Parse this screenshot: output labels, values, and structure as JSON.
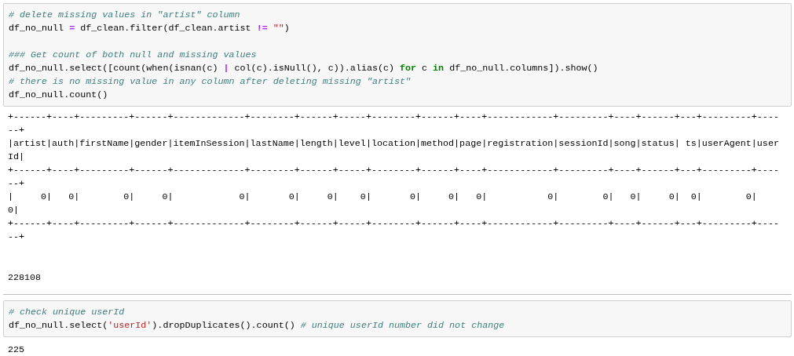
{
  "cells": [
    {
      "code": [
        {
          "tokens": [
            {
              "kind": "comment",
              "text": "# delete missing values in \"artist\" column"
            }
          ]
        },
        {
          "tokens": [
            {
              "kind": "plain",
              "text": "df_no_null "
            },
            {
              "kind": "operator",
              "text": "="
            },
            {
              "kind": "plain",
              "text": " df_clean.filter(df_clean.artist "
            },
            {
              "kind": "operator",
              "text": "!="
            },
            {
              "kind": "string",
              "text": " \"\""
            },
            {
              "kind": "plain",
              "text": ")"
            }
          ]
        },
        {
          "kind": "blank"
        },
        {
          "tokens": [
            {
              "kind": "comment",
              "text": "### Get count of both null and missing values"
            }
          ]
        },
        {
          "tokens": [
            {
              "kind": "plain",
              "text": "df_no_null.select([count(when(isnan(c) "
            },
            {
              "kind": "operator",
              "text": "|"
            },
            {
              "kind": "plain",
              "text": " col(c).isNull(), c)).alias(c) "
            },
            {
              "kind": "keyword",
              "text": "for"
            },
            {
              "kind": "plain",
              "text": " c "
            },
            {
              "kind": "keyword",
              "text": "in"
            },
            {
              "kind": "plain",
              "text": " df_no_null.columns]).show()"
            }
          ]
        },
        {
          "tokens": [
            {
              "kind": "comment",
              "text": "# there is no missing value in any column after deleting missing \"artist\""
            }
          ]
        },
        {
          "tokens": [
            {
              "kind": "plain",
              "text": "df_no_null.count()"
            }
          ]
        }
      ],
      "outputs": [
        {
          "kind": "stream",
          "lines": [
            "+------+----+---------+------+-------------+--------+------+-----+--------+------+----+------------+---------+----+------+---+---------+----",
            "--+",
            "|artist|auth|firstName|gender|itemInSession|lastName|length|level|location|method|page|registration|sessionId|song|status| ts|userAgent|user",
            "Id|",
            "+------+----+---------+------+-------------+--------+------+-----+--------+------+----+------------+---------+----+------+---+---------+----",
            "--+",
            "|     0|   0|        0|     0|            0|       0|     0|    0|       0|     0|   0|           0|        0|   0|     0|  0|        0|    ",
            "0|",
            "+------+----+---------+------+-------------+--------+------+-----+--------+------+----+------------+---------+----+------+---+---------+----",
            "--+"
          ]
        },
        {
          "kind": "result",
          "lines": [
            "228108"
          ]
        }
      ]
    },
    {
      "code": [
        {
          "tokens": [
            {
              "kind": "comment",
              "text": "# check unique userId"
            }
          ]
        },
        {
          "tokens": [
            {
              "kind": "plain",
              "text": "df_no_null.select("
            },
            {
              "kind": "string",
              "text": "'userId'"
            },
            {
              "kind": "plain",
              "text": ").dropDuplicates().count() "
            },
            {
              "kind": "comment",
              "text": "# unique userId number did not change"
            }
          ]
        }
      ],
      "outputs": [
        {
          "kind": "result",
          "lines": [
            "225"
          ]
        }
      ]
    }
  ]
}
